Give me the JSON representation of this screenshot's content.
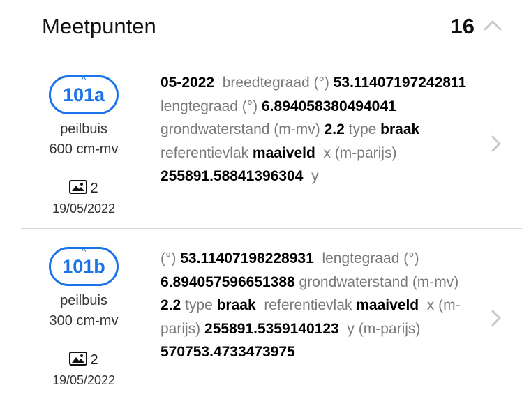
{
  "header": {
    "title": "Meetpunten",
    "count": "16"
  },
  "points": [
    {
      "badge": "101a",
      "type": "peilbuis",
      "depth": "600 cm-mv",
      "photo_count": "2",
      "date": "19/05/2022",
      "date_prefix": "05-2022",
      "lat_label": "breedtegraad (°)",
      "lat_value": "53.11407197242811",
      "lon_label": "lengtegraad (°)",
      "lon_value": "6.894058380494041",
      "gw_label": "grondwaterstand (m-mv)",
      "gw_value": "2.2",
      "type_label": "type",
      "type_value": "braak",
      "ref_label": "referentievlak",
      "ref_value": "maaiveld",
      "x_label": "x (m-parijs)",
      "x_value": "255891.58841396304",
      "y_label": "y"
    },
    {
      "badge": "101b",
      "type": "peilbuis",
      "depth": "300 cm-mv",
      "photo_count": "2",
      "date": "19/05/2022",
      "lat_label": "(°)",
      "lat_value": "53.11407198228931",
      "lon_label": "lengtegraad (°)",
      "lon_value": "6.894057596651388",
      "gw_label": "grondwaterstand (m-mv)",
      "gw_value": "2.2",
      "type_label": "type",
      "type_value": "braak",
      "ref_label": "referentievlak",
      "ref_value": "maaiveld",
      "x_label": "x (m-parijs)",
      "x_value": "255891.5359140123",
      "y_label": "y (m-parijs)",
      "y_value": "570753.4733473975"
    }
  ],
  "icons": {
    "collapse": "chevron-up-icon",
    "photo": "image-icon",
    "disclosure": "chevron-right-icon"
  },
  "colors": {
    "accent": "#1a73e8",
    "label": "#7a7a7a",
    "chevron": "#c7c7cc"
  }
}
